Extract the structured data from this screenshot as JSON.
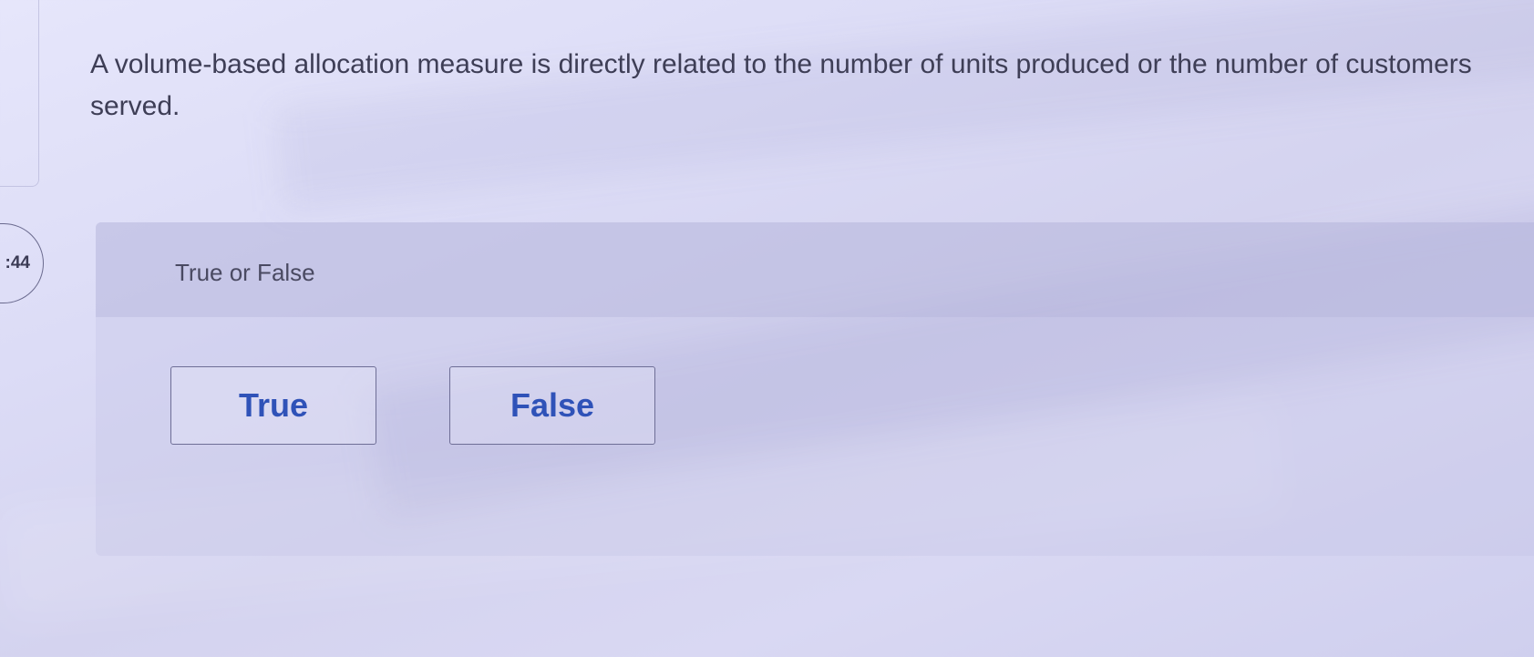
{
  "question": {
    "text": "A volume-based allocation measure is directly related to the number of units produced or the number of customers served."
  },
  "timer": {
    "label": ":44"
  },
  "answer_section": {
    "prompt": "True or False",
    "options": [
      {
        "label": "True"
      },
      {
        "label": "False"
      }
    ]
  },
  "colors": {
    "background": "#dcdcf6",
    "text": "#3e3e56",
    "button_text": "#2f52b8",
    "button_border": "#6e6e96"
  }
}
